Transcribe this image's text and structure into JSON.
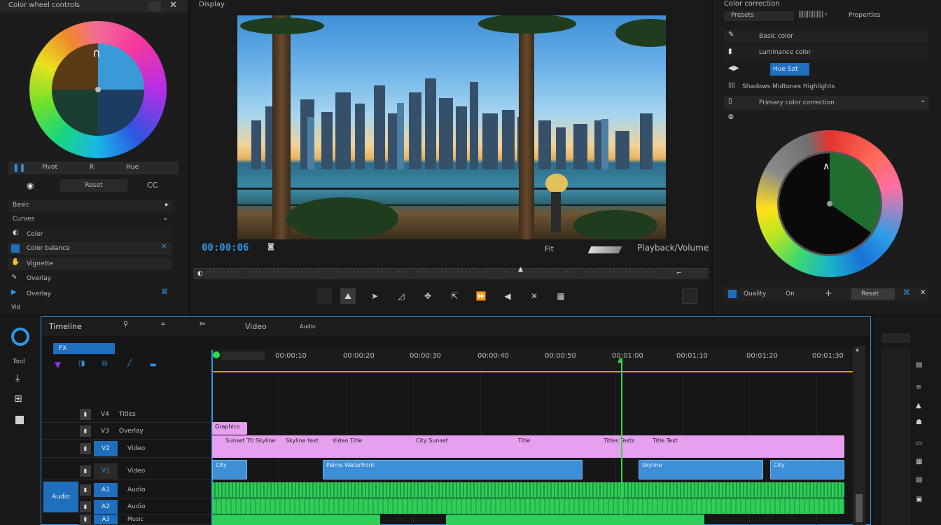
{
  "left_panel": {
    "title": "Color wheel controls",
    "row1": [
      "Pivot",
      "R",
      "Hue"
    ],
    "row2": [
      "Reset",
      "CC"
    ],
    "sections": [
      {
        "label": "Basic",
        "icon": "chevron-right-icon"
      },
      {
        "label": "Curves",
        "icon": "chevron-down-icon"
      },
      {
        "label": "Color",
        "icon": "circle-icon"
      },
      {
        "label": "Color balance",
        "icon": "square-icon"
      },
      {
        "label": "Vignette",
        "icon": "play-icon"
      },
      {
        "label": "Overlay",
        "icon": "check-icon"
      }
    ]
  },
  "viewer": {
    "title": "Display",
    "timecode": "00:00:06",
    "zoom": "Fit",
    "status": "Playback/Volume",
    "transport": [
      "square-icon",
      "delete-icon",
      "next-icon",
      "crop-icon",
      "move-icon",
      "transform-icon",
      "fast-forward-icon",
      "rewind-icon",
      "close-icon",
      "grid-icon"
    ]
  },
  "right_panel": {
    "title": "Color correction",
    "header_tabs": [
      "Presets",
      "Properties"
    ],
    "rows": [
      {
        "label": "Basic color"
      },
      {
        "label": "Luminance color"
      },
      {
        "label": "Hue Sat"
      },
      {
        "label": "Shadows Midtones Highlights"
      },
      {
        "label": "Primary color correction"
      }
    ],
    "bottom": [
      "Quality",
      "On",
      "+",
      "Reset"
    ]
  },
  "timeline": {
    "title": "Timeline",
    "tool_labels": [
      "Video",
      "Audio",
      "FX"
    ],
    "ruler": [
      "00:00:10",
      "00:00:20",
      "00:00:30",
      "00:00:40",
      "00:00:50",
      "00:01:00",
      "00:01:10",
      "00:01:20",
      "00:01:30"
    ],
    "tracks": [
      {
        "name": "V4",
        "label": "Titles"
      },
      {
        "name": "V3",
        "label": "Overlay"
      },
      {
        "name": "V2",
        "label": "Video"
      },
      {
        "name": "V1",
        "label": "Video"
      },
      {
        "name": "A1",
        "label": "Audio"
      },
      {
        "name": "A2",
        "label": "Audio"
      },
      {
        "name": "A3",
        "label": "Music"
      }
    ],
    "clips": {
      "title": "Graphics",
      "pink": [
        "Sunset Ttl Skyline",
        "Skyline text",
        "Video Title",
        "City Sunset",
        "Title",
        "Titles Texts",
        "Title Text"
      ],
      "blue": [
        "City",
        "Palms Waterfront",
        "Skyline",
        "City"
      ]
    },
    "colors": {
      "accent": "#2f95e6",
      "playhead": "#33d94a",
      "pink": "#e79ff0",
      "blue": "#3d8fd8",
      "green": "#2fcd59"
    }
  }
}
